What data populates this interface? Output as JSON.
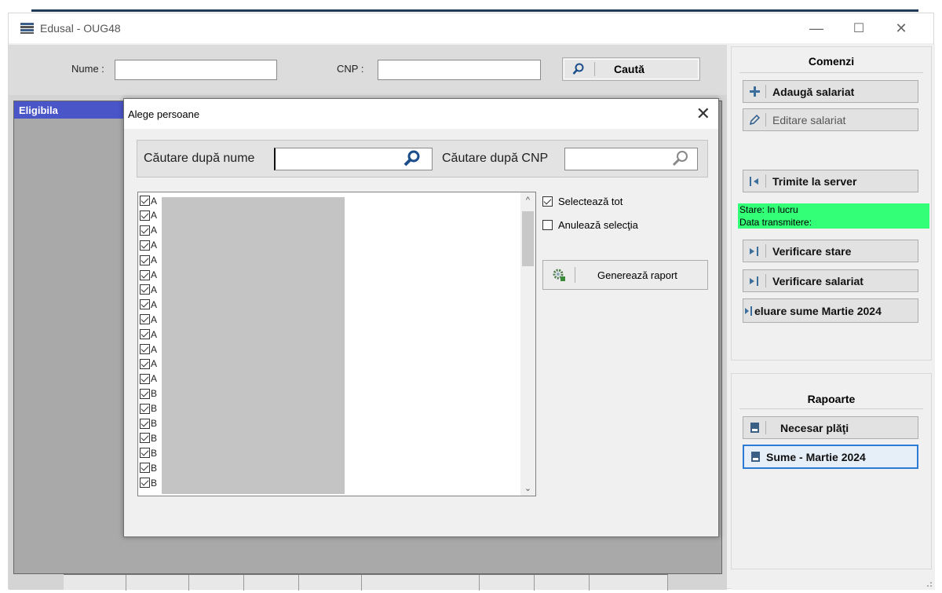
{
  "window": {
    "title": "Edusal - OUG48",
    "controls": [
      "—",
      "☐",
      "✕"
    ]
  },
  "search_bar": {
    "name_label": "Nume :",
    "name_value": "",
    "cnp_label": "CNP :",
    "cnp_value": "",
    "search_button": "Caută"
  },
  "grid": {
    "active_tab": "Eligibila"
  },
  "commands_panel": {
    "title": "Comenzi",
    "buttons": [
      {
        "label": "Adaugă salariat",
        "icon": "plus-icon"
      },
      {
        "label": "Editare salariat",
        "icon": "pencil-icon"
      },
      {
        "label": "Trimite la server",
        "icon": "send-to-server-icon"
      },
      {
        "label": "Verificare stare",
        "icon": "check-status-icon"
      },
      {
        "label": "Verificare salariat",
        "icon": "check-employee-icon"
      },
      {
        "label": "eluare sume Martie 2024",
        "icon": "import-sums-icon"
      }
    ],
    "status_text": "Stare: In lucru",
    "transmit_text": "Data transmitere:",
    "status_color": "#33ff77"
  },
  "reports_panel": {
    "title": "Rapoarte",
    "buttons": [
      {
        "label": "Necesar plăţi",
        "icon": "report-icon"
      },
      {
        "label": "Sume - Martie 2024",
        "icon": "report-icon"
      }
    ]
  },
  "dialog": {
    "title": "Alege persoane",
    "close": "✕",
    "search_by_name_label": "Căutare după nume",
    "search_by_name_value": "",
    "search_by_cnp_label": "Căutare după CNP",
    "search_by_cnp_value": "",
    "select_all": "Selectează tot",
    "select_all_checked": true,
    "clear_selection": "Anulează selecţia",
    "clear_selection_checked": false,
    "generate_button": "Generează raport",
    "list_items": [
      {
        "text": "A",
        "checked": true
      },
      {
        "text": "A",
        "checked": true
      },
      {
        "text": "A",
        "checked": true
      },
      {
        "text": "A",
        "checked": true
      },
      {
        "text": "A",
        "checked": true
      },
      {
        "text": "A",
        "checked": true
      },
      {
        "text": "A",
        "checked": true
      },
      {
        "text": "A",
        "checked": true
      },
      {
        "text": "A",
        "checked": true
      },
      {
        "text": "A",
        "checked": true
      },
      {
        "text": "A",
        "checked": true
      },
      {
        "text": "A",
        "checked": true
      },
      {
        "text": "A",
        "checked": true
      },
      {
        "text": "B",
        "checked": true
      },
      {
        "text": "B",
        "checked": true
      },
      {
        "text": "B",
        "checked": true
      },
      {
        "text": "B",
        "checked": true
      },
      {
        "text": "B",
        "checked": true
      },
      {
        "text": "B",
        "checked": true
      },
      {
        "text": "B",
        "checked": true
      }
    ]
  },
  "colors": {
    "tab_blue": "#4a55c8",
    "focus_blue": "#2b7bd4"
  }
}
